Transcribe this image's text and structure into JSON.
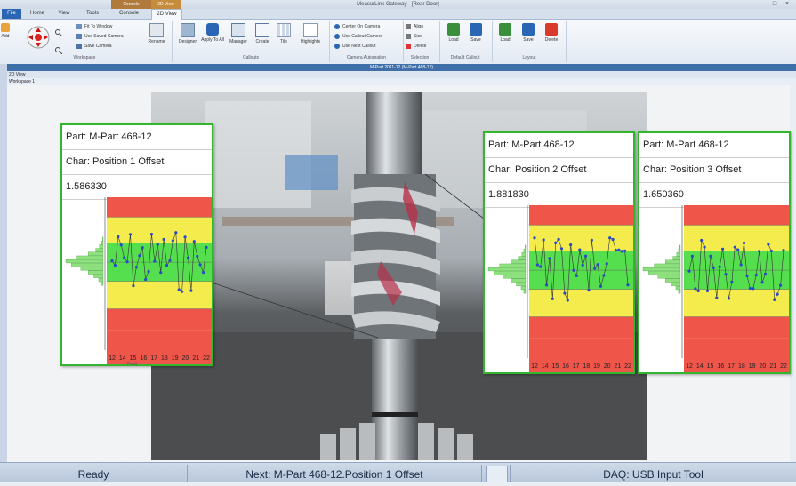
{
  "window": {
    "title": "MeasurLink Gateway - [Rear Door]",
    "context_groups": [
      "Console",
      "2D View"
    ]
  },
  "tabs": [
    {
      "label": "File"
    },
    {
      "label": "Home"
    },
    {
      "label": "View"
    },
    {
      "label": "Tools"
    },
    {
      "label": "Console"
    },
    {
      "label": "2D View"
    }
  ],
  "ribbon": {
    "add_label": "Add",
    "workspace": {
      "items": [
        "Fit To Window",
        "Use Saved Camera",
        "Save Camera"
      ],
      "group_label": "Workspace"
    },
    "rename_label": "Rename",
    "callouts": {
      "buttons": [
        "Designer",
        "Apply To All",
        "Manager",
        "Create",
        "Tile",
        "Highlights"
      ],
      "group_label": "Callouts"
    },
    "camera_automation": {
      "items": [
        "Center On Camera",
        "Use Callout Camera",
        "Use Next Callout"
      ],
      "group_label": "Camera Automation"
    },
    "selection": {
      "items": [
        "Align",
        "Size",
        "Delete"
      ],
      "group_label": "Selection"
    },
    "default_callout": {
      "buttons": [
        "Load",
        "Save"
      ],
      "group_label": "Default Callout"
    },
    "layout": {
      "buttons": [
        "Load",
        "Save",
        "Delete"
      ],
      "group_label": "Layout"
    }
  },
  "document": {
    "title": "M-Part 2011-12 (M-Part 468-12)",
    "view_label": "2D View",
    "workspace_label": "Workspace 1"
  },
  "callouts": [
    {
      "part": "Part: M-Part 468-12",
      "char": "Char: Position 1 Offset",
      "value": "1.586330",
      "footer": "Pos1",
      "x_ticks": [
        "12",
        "14",
        "15",
        "16",
        "17",
        "18",
        "19",
        "20",
        "21",
        "22"
      ]
    },
    {
      "part": "Part: M-Part 468-12",
      "char": "Char: Position 2 Offset",
      "value": "1.881830",
      "footer": "",
      "x_ticks": [
        "12",
        "14",
        "15",
        "16",
        "17",
        "18",
        "19",
        "20",
        "21",
        "22"
      ]
    },
    {
      "part": "Part: M-Part 468-12",
      "char": "Char: Position 3 Offset",
      "value": "1.650360",
      "footer": "",
      "x_ticks": [
        "12",
        "14",
        "15",
        "16",
        "17",
        "18",
        "19",
        "20",
        "21",
        "22"
      ]
    }
  ],
  "status": {
    "ready": "Ready",
    "next": "Next: M-Part 468-12.Position 1 Offset",
    "daq": "DAQ: USB Input Tool"
  },
  "colors": {
    "callout_border": "#33b52d",
    "zone_red": "#f0554a",
    "zone_yellow": "#f4ec4c",
    "zone_green": "#55df4e",
    "point": "#2a49c8",
    "status_bar": "#c4d2e4"
  }
}
